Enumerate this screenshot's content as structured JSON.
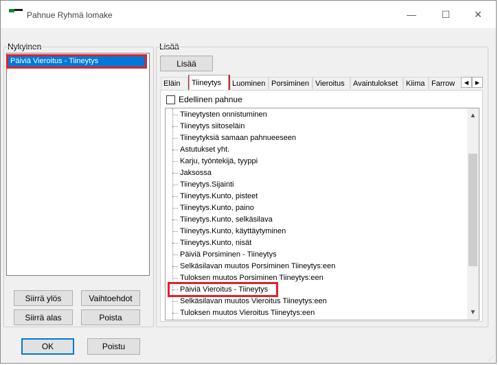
{
  "window": {
    "title": "Pahnue Ryhmä lomake"
  },
  "colors": {
    "selection": "#0078d7",
    "highlight_border": "#e0202a",
    "logo_green": "#0a8a2a"
  },
  "left_group": {
    "label": "Nykyinen",
    "items": [
      "Päiviä Vieroitus - Tiineytys"
    ]
  },
  "left_buttons": {
    "move_up": "Siirrä ylös",
    "options": "Vaihtoehdot",
    "move_down": "Siirrä alas",
    "remove": "Poista"
  },
  "bottom_buttons": {
    "ok": "OK",
    "exit": "Poistu"
  },
  "right_group": {
    "label": "Lisää",
    "add_button": "Lisää"
  },
  "tabs": [
    "Eläin",
    "Tiineytys",
    "Luominen",
    "Porsiminen",
    "Vieroitus",
    "Avaintulokset",
    "Kiima",
    "Farrow"
  ],
  "active_tab": "Tiineytys",
  "previous_checkbox": {
    "label": "Edellinen pahnue",
    "checked": false
  },
  "tree_items": [
    "Tiineytysten onnistuminen",
    "Tiineytys siitoseläin",
    "Tiineytyksiä samaan pahnueeseen",
    "Astutukset yht.",
    "Karju, työntekijä, tyyppi",
    "Jaksossa",
    "Tiineytys.Sijainti",
    "Tiineytys.Kunto, pisteet",
    "Tiineytys.Kunto, paino",
    "Tiineytys.Kunto, selkäsilava",
    "Tiineytys.Kunto, käyttäytyminen",
    "Tiineytys.Kunto, nisät",
    "Päiviä Porsiminen - Tiineytys",
    "Selkäsilavan muutos Porsiminen Tiineytys:een",
    "Tuloksen muutos Porsiminen Tiineytys:een",
    "Päiviä Vieroitus - Tiineytys",
    "Selkäsilavan muutos Vieroitus Tiineytys:een",
    "Tuloksen muutos Vieroitus Tiineytys:een"
  ],
  "icons": {
    "minimize": "minimize-icon",
    "maximize": "maximize-icon",
    "close": "close-icon",
    "tab_left": "chevron-left-icon",
    "tab_right": "chevron-right-icon",
    "scroll_up": "chevron-up-icon",
    "scroll_down": "chevron-down-icon"
  }
}
